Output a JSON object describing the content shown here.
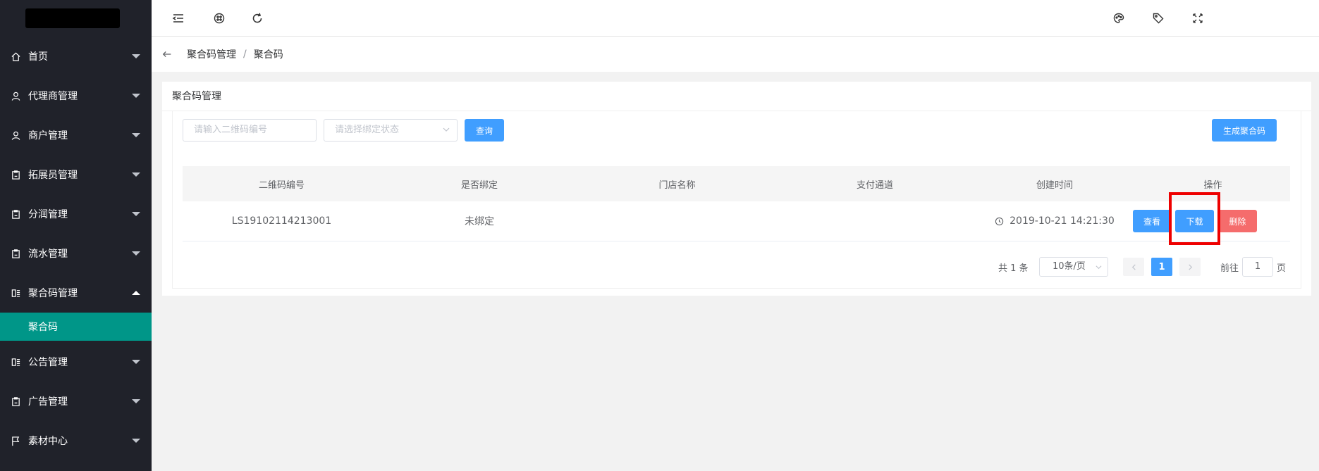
{
  "sidebar": {
    "items": [
      {
        "label": "首页",
        "icon": "home-icon"
      },
      {
        "label": "代理商管理",
        "icon": "user-icon"
      },
      {
        "label": "商户管理",
        "icon": "user-icon"
      },
      {
        "label": "拓展员管理",
        "icon": "clipboard-icon"
      },
      {
        "label": "分润管理",
        "icon": "clipboard-icon"
      },
      {
        "label": "流水管理",
        "icon": "clipboard-icon"
      },
      {
        "label": "聚合码管理",
        "icon": "list-icon"
      },
      {
        "label": "公告管理",
        "icon": "list-icon"
      },
      {
        "label": "广告管理",
        "icon": "clipboard-icon"
      },
      {
        "label": "素材中心",
        "icon": "flag-icon"
      }
    ],
    "active_sub": "聚合码"
  },
  "breadcrumb": {
    "parent": "聚合码管理",
    "separator": "/",
    "current": "聚合码"
  },
  "card": {
    "title": "聚合码管理"
  },
  "filters": {
    "code_placeholder": "请输入二维码编号",
    "status_placeholder": "请选择绑定状态",
    "query_label": "查询",
    "generate_label": "生成聚合码"
  },
  "table": {
    "headers": [
      "二维码编号",
      "是否绑定",
      "门店名称",
      "支付通道",
      "创建时间",
      "操作"
    ],
    "rows": [
      {
        "code": "LS19102114213001",
        "bound": "未绑定",
        "store": "",
        "channel": "",
        "created": "2019-10-21 14:21:30"
      }
    ],
    "actions": {
      "view": "查看",
      "download": "下载",
      "delete": "删除"
    }
  },
  "pagination": {
    "total_text": "共 1 条",
    "page_size": "10条/页",
    "current_page": "1",
    "goto_prefix": "前往",
    "goto_value": "1",
    "goto_suffix": "页"
  },
  "colors": {
    "sidebar_bg": "#20222a",
    "active": "#009688",
    "primary": "#409eff",
    "danger": "#f56c6c",
    "highlight": "#ee0000"
  }
}
